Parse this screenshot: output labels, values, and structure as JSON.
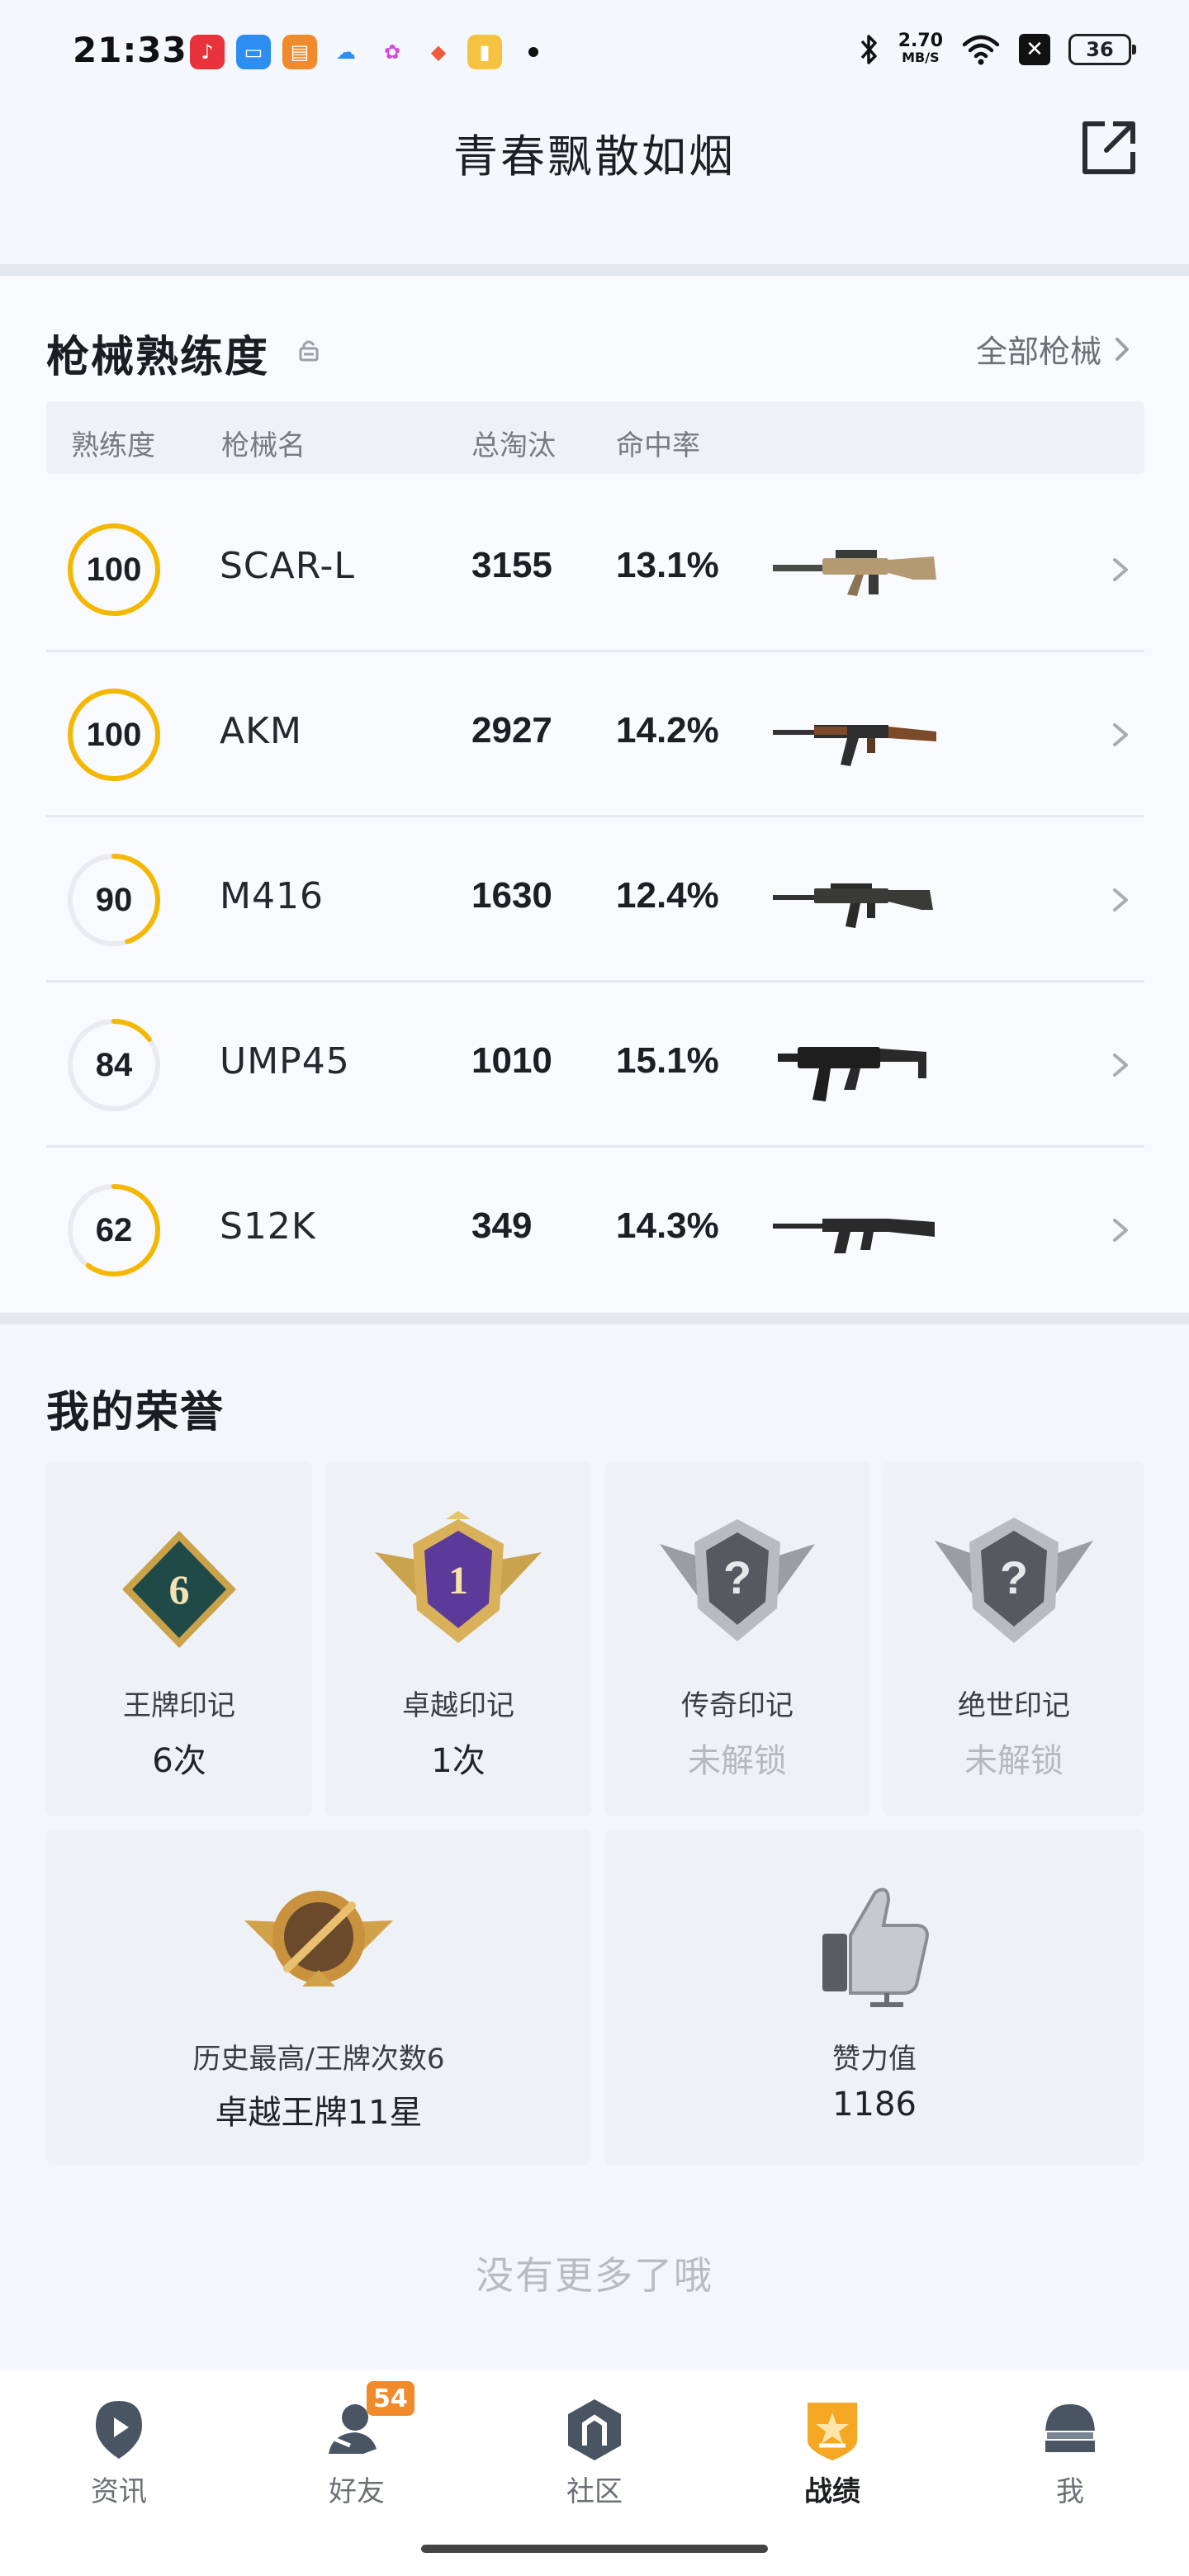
{
  "status_bar": {
    "time": "21:33",
    "net_speed_value": "2.70",
    "net_speed_unit": "MB/S",
    "battery": "36",
    "icons": [
      "bluetooth-icon",
      "wifi-icon"
    ]
  },
  "header": {
    "title": "青春飘散如烟"
  },
  "weapons": {
    "title": "枪械熟练度",
    "all_label": "全部枪械",
    "columns": [
      "熟练度",
      "枪械名",
      "总淘汰",
      "命中率"
    ],
    "rows": [
      {
        "proficiency": "100",
        "name": "SCAR-L",
        "kills": "3155",
        "hit_rate": "13.1%",
        "progress": 1.0
      },
      {
        "proficiency": "100",
        "name": "AKM",
        "kills": "2927",
        "hit_rate": "14.2%",
        "progress": 1.0
      },
      {
        "proficiency": "90",
        "name": "M416",
        "kills": "1630",
        "hit_rate": "12.4%",
        "progress": 0.45
      },
      {
        "proficiency": "84",
        "name": "UMP45",
        "kills": "1010",
        "hit_rate": "15.1%",
        "progress": 0.15
      },
      {
        "proficiency": "62",
        "name": "S12K",
        "kills": "349",
        "hit_rate": "14.3%",
        "progress": 0.6
      }
    ],
    "ring_color": "#f5b800"
  },
  "honors": {
    "title": "我的荣誉",
    "cards": [
      {
        "name": "王牌印记",
        "value": "6次",
        "locked": false
      },
      {
        "name": "卓越印记",
        "value": "1次",
        "locked": false
      },
      {
        "name": "传奇印记",
        "value": "未解锁",
        "locked": true
      },
      {
        "name": "绝世印记",
        "value": "未解锁",
        "locked": true
      }
    ],
    "wide_cards": [
      {
        "name": "历史最高/王牌次数6",
        "value": "卓越王牌11星"
      },
      {
        "name": "赞力值",
        "value": "1186"
      }
    ]
  },
  "footer": {
    "no_more": "没有更多了哦"
  },
  "nav": {
    "items": [
      {
        "label": "资讯",
        "icon": "news-icon"
      },
      {
        "label": "好友",
        "icon": "friends-icon",
        "badge": "54"
      },
      {
        "label": "社区",
        "icon": "community-icon"
      },
      {
        "label": "战绩",
        "icon": "record-icon",
        "active": true
      },
      {
        "label": "我",
        "icon": "profile-icon"
      }
    ]
  }
}
